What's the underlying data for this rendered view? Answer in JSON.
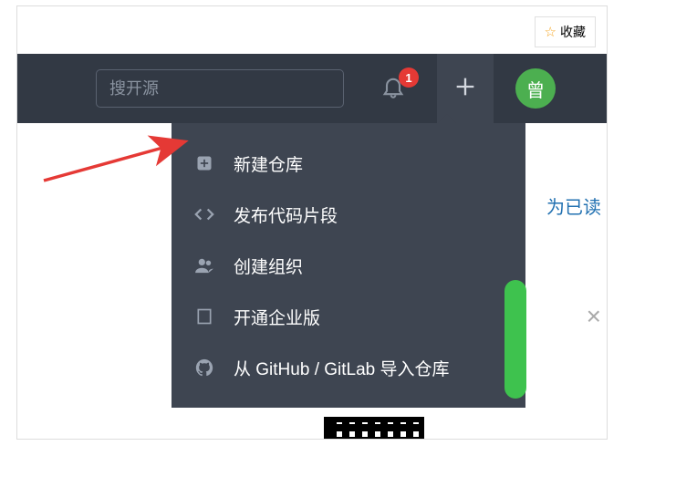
{
  "bookmark": {
    "label": "收藏"
  },
  "header": {
    "search_placeholder": "搜开源",
    "notification_count": "1",
    "avatar_letter": "曾"
  },
  "dropdown": {
    "items": [
      {
        "label": "新建仓库"
      },
      {
        "label": "发布代码片段"
      },
      {
        "label": "创建组织"
      },
      {
        "label": "开通企业版"
      },
      {
        "label": "从 GitHub / GitLab 导入仓库"
      }
    ]
  },
  "links": {
    "mark_read": "为已读"
  }
}
